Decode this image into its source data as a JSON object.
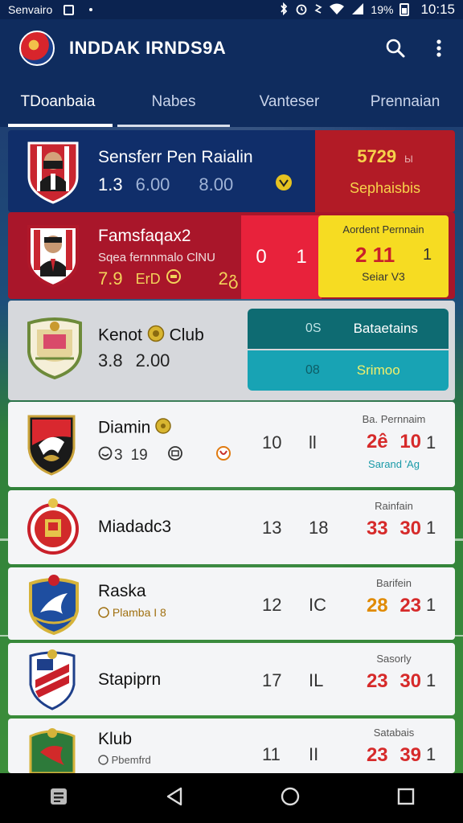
{
  "status_bar": {
    "carrier": "Senvairo",
    "battery": "19%",
    "time": "10:15"
  },
  "app_bar": {
    "title": "INDDAK IRNDS9A"
  },
  "tabs": [
    {
      "label": "TDoanbaia"
    },
    {
      "label": "Nabes"
    },
    {
      "label": "Vanteser"
    },
    {
      "label": "Prennaian"
    }
  ],
  "rows": [
    {
      "team": "Sensferr Pen Raialin",
      "stats": [
        "1.3",
        "6.00",
        "8.00"
      ],
      "score": "5729",
      "score_small": "Ы",
      "panel_label": "Sephaisbis"
    },
    {
      "team": "Famsfaqax2",
      "subtitle": "Sqea fernnmalo ClNU",
      "stats": [
        "7.9",
        "ErD"
      ],
      "badge": "2გ",
      "red_a": "0",
      "red_b": "1",
      "yellow_label": "Aordent Pernnain",
      "yellow_score": "2 11",
      "yellow_last": "1",
      "yellow_sub": "Seiar V3"
    },
    {
      "team": "Kenot",
      "team_suffix": "Club",
      "stats": [
        "3.8",
        "2.00"
      ],
      "teal1_num": "0S",
      "teal1_label": "Bataetains",
      "teal2_num": "08",
      "teal2_label": "Srimoo"
    },
    {
      "team": "Diamin",
      "stats": [
        "3",
        "19"
      ],
      "c1": "10",
      "c2": "ll",
      "label": "Ba. Pernnaim",
      "score_a": "2ê",
      "score_b": "10",
      "sub": "Sarand 'Ag",
      "last": "1"
    },
    {
      "team": "Miadadc3",
      "c1": "13",
      "c2": "18",
      "label": "Rainfain",
      "score_a": "33",
      "score_b": "30",
      "last": "1"
    },
    {
      "team": "Raska",
      "subtitle": "Plamba I 8",
      "c1": "12",
      "c2": "IC",
      "label": "Barifein",
      "score_a": "28",
      "score_b": "23",
      "last": "1"
    },
    {
      "team": "Stapiprn",
      "c1": "17",
      "c2": "IL",
      "label": "Sasorly",
      "score_a": "23",
      "score_b": "30",
      "last": "1"
    },
    {
      "team": "Klub",
      "subtitle": "Pbemfrd",
      "c1": "11",
      "c2": "II",
      "label": "Satabais",
      "score_a": "23",
      "score_b": "39",
      "last": "1"
    }
  ],
  "colors": {
    "app_bar": "#0f2c5e",
    "accent_red": "#b21b26",
    "accent_yellow": "#f6dc22",
    "teal_dark": "#0e6b72",
    "teal_light": "#18a3b4",
    "score_red": "#d62a2a"
  },
  "icons": [
    "search-icon",
    "more-vert-icon",
    "back-icon",
    "home-icon",
    "recents-icon",
    "notes-icon"
  ]
}
